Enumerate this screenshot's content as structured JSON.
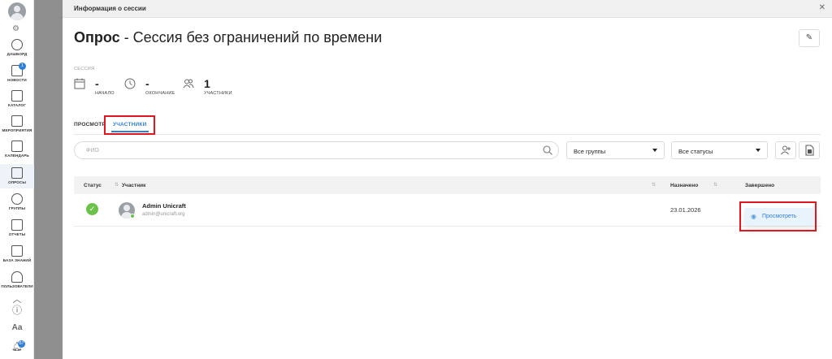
{
  "sidebar": {
    "items": [
      {
        "label": "ДАШБОРД",
        "icon": "dashboard-icon"
      },
      {
        "label": "НОВОСТИ",
        "icon": "news-icon",
        "badge": "1"
      },
      {
        "label": "КАТАЛОГ",
        "icon": "catalog-icon"
      },
      {
        "label": "МЕРОПРИЯТИЯ",
        "icon": "events-icon"
      },
      {
        "label": "КАЛЕНДАРЬ",
        "icon": "calendar-icon"
      },
      {
        "label": "ОПРОСЫ",
        "icon": "surveys-icon",
        "active": true
      },
      {
        "label": "ГРУППЫ",
        "icon": "groups-icon"
      },
      {
        "label": "ОТЧЕТЫ",
        "icon": "reports-icon"
      },
      {
        "label": "БАЗА ЗНАНИЙ",
        "icon": "knowledge-base-icon"
      },
      {
        "label": "ПОЛЬЗОВАТЕЛИ",
        "icon": "users-icon"
      }
    ],
    "notifications_badge": "67"
  },
  "panel": {
    "header_title": "Информация о сессии",
    "title_bold": "Опрос",
    "title_rest": " - Сессия без ограничений по времени"
  },
  "session": {
    "section_label": "СЕССИЯ",
    "start": {
      "value": "-",
      "label": "НАЧАЛО"
    },
    "end": {
      "value": "-",
      "label": "ОКОНЧАНИЕ"
    },
    "participants": {
      "value": "1",
      "label": "УЧАСТНИКИ"
    }
  },
  "tabs": [
    {
      "label": "ПРОСМОТР"
    },
    {
      "label": "УЧАСТНИКИ",
      "active": true
    }
  ],
  "filters": {
    "search_placeholder": "ФИО",
    "groups_value": "Все группы",
    "statuses_value": "Все статусы"
  },
  "table": {
    "headers": {
      "status": "Статус",
      "participant": "Участник",
      "assigned": "Назначено",
      "completed": "Завершено"
    },
    "rows": [
      {
        "name": "Admin Unicraft",
        "email": "admin@unicraft.org",
        "assigned": "23.01.2026",
        "action": "Просмотреть"
      }
    ]
  },
  "colors": {
    "accent": "#2f7fd6",
    "success": "#6cc24a",
    "highlight": "#e0171e"
  }
}
